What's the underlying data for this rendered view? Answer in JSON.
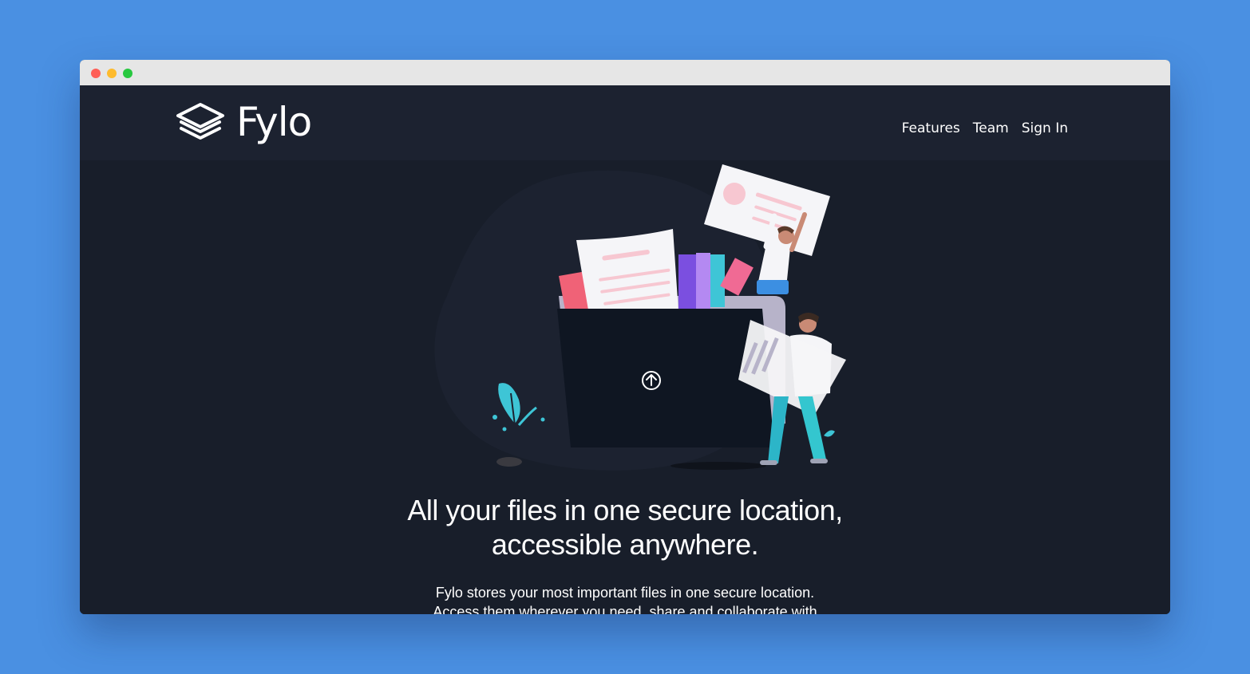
{
  "window": {
    "controls": [
      "close",
      "minimize",
      "maximize"
    ]
  },
  "brand": {
    "name": "Fylo",
    "logo_icon": "stacked-layers-icon"
  },
  "nav": {
    "items": [
      {
        "label": "Features"
      },
      {
        "label": "Team"
      },
      {
        "label": "Sign In"
      }
    ]
  },
  "hero": {
    "headline_line1": "All your files in one secure location,",
    "headline_line2": "accessible anywhere.",
    "description_line1": "Fylo stores your most important files in one secure location.",
    "description_line2": "Access them wherever you need, share and collaborate with",
    "illustration_icon": "upload-arrow-icon"
  },
  "colors": {
    "page_background": "#4a90e2",
    "header_background": "#1c2230",
    "hero_background": "#181e2a",
    "accent_cyan": "#3ec5d6"
  }
}
